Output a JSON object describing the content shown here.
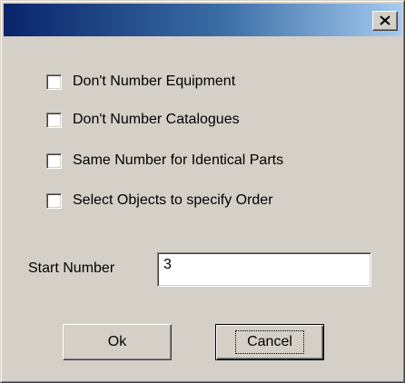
{
  "title_bar": {
    "close_glyph": "close-x-icon"
  },
  "options": [
    {
      "label": "Don't Number Equipment",
      "checked": false
    },
    {
      "label": "Don't Number Catalogues",
      "checked": false
    },
    {
      "label": "Same Number for Identical Parts",
      "checked": false
    },
    {
      "label": "Select Objects to specify Order",
      "checked": false
    }
  ],
  "start_number": {
    "label": "Start Number",
    "value": "3"
  },
  "buttons": {
    "ok_label": "Ok",
    "cancel_label": "Cancel"
  },
  "colors": {
    "dialog_face": "#d4d0c8",
    "title_start": "#0a246a",
    "title_end": "#a6caf0"
  }
}
